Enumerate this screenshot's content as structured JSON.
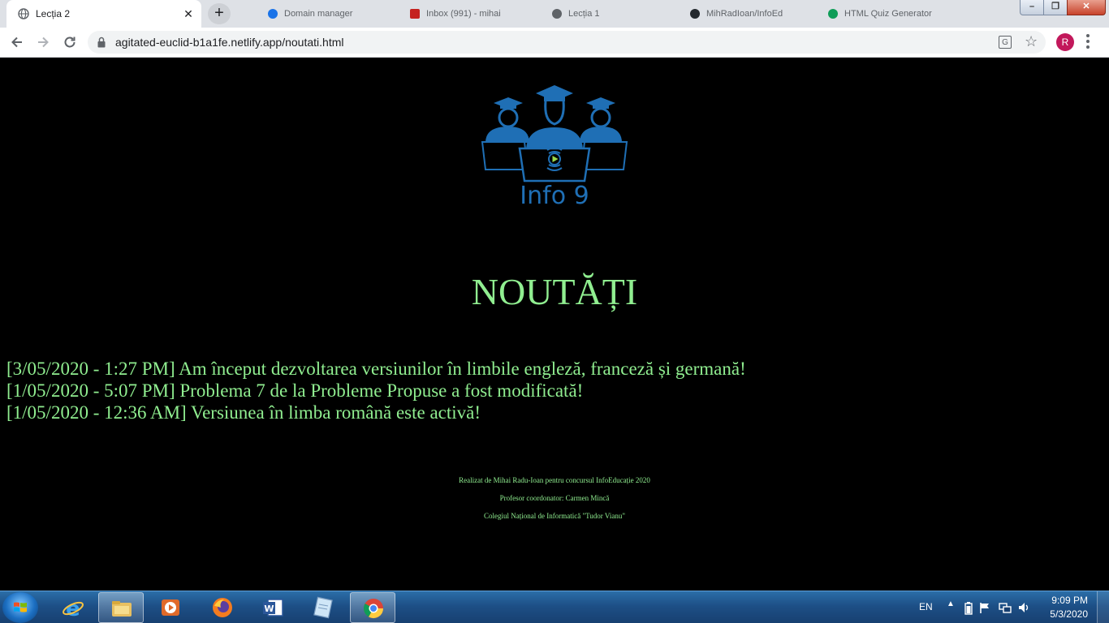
{
  "browser": {
    "active_tab_title": "Lecția 2",
    "background_tabs": [
      {
        "label": "Domain manager",
        "color": "#1a73e8"
      },
      {
        "label": "Inbox (991) - mihai",
        "color": "#c5221f"
      },
      {
        "label": "Lecția 1",
        "color": "#5f6368"
      },
      {
        "label": "MihRadIoan/InfoEd",
        "color": "#24292e"
      },
      {
        "label": "HTML Quiz Generator",
        "color": "#0f9d58"
      }
    ],
    "url": "agitated-euclid-b1a1fe.netlify.app/noutati.html",
    "profile_initial": "R",
    "translate_glyph": "G"
  },
  "page": {
    "logo_text": "Info 9",
    "heading": "NOUTĂȚI",
    "news": [
      "[3/05/2020 - 1:27 PM] Am început dezvoltarea versiunilor în limbile engleză, franceză și germană!",
      "[1/05/2020 - 5:07 PM] Problema 7 de la Probleme Propuse a fost modificată!",
      "[1/05/2020 - 12:36 AM] Versiunea în limba română este activă!"
    ],
    "footer": [
      "Realizat de Mihai Radu-Ioan pentru concursul InfoEducație 2020",
      "Profesor coordonator: Carmen Mincă",
      "Colegiul Național de Informatică \"Tudor Vianu\""
    ]
  },
  "taskbar": {
    "apps": [
      "internet-explorer-icon",
      "file-explorer-icon",
      "media-player-icon",
      "firefox-icon",
      "word-icon",
      "notepad-icon",
      "chrome-icon"
    ],
    "language": "EN",
    "time": "9:09 PM",
    "date": "5/3/2020"
  },
  "colors": {
    "page_bg": "#000000",
    "text_green": "#90ee90",
    "logo_blue": "#1f6fb5"
  }
}
